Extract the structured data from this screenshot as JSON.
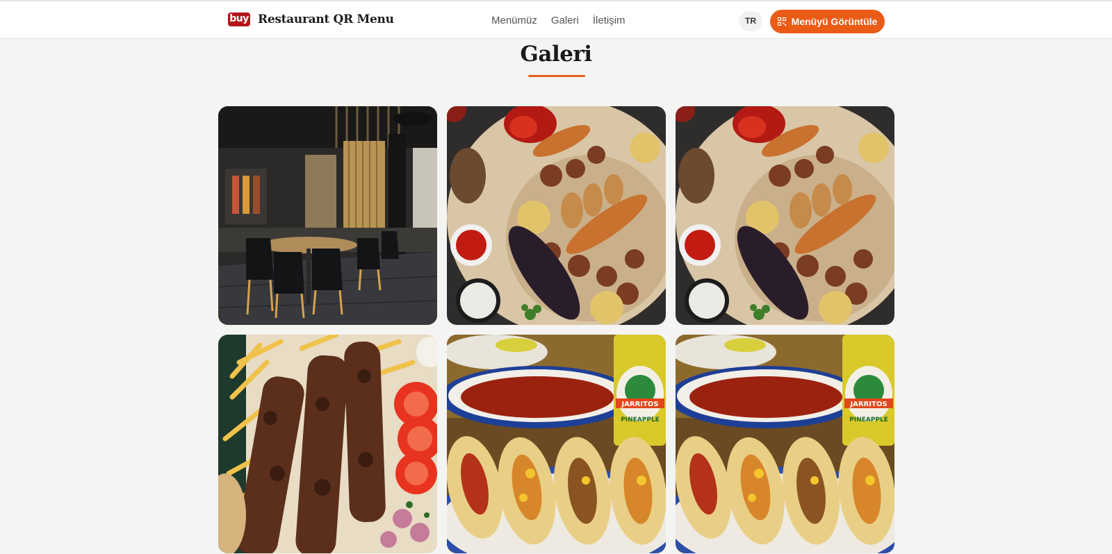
{
  "header": {
    "logo_text": "buy",
    "brand_name": "Restaurant QR Menu",
    "nav": [
      "Menümüz",
      "Galeri",
      "İletişim"
    ],
    "language": "TR",
    "cta_label": "Menüyü Görüntüle",
    "cta_icon": "qr-code-icon"
  },
  "colors": {
    "accent": "#ea5b16",
    "logo": "#b3141b",
    "background": "#f4f4f2"
  },
  "gallery": {
    "title": "Galeri",
    "images": [
      {
        "name": "gallery-image-restaurant-interior",
        "subject": "restaurant interior"
      },
      {
        "name": "gallery-image-mixed-grill",
        "subject": "mixed grill platter"
      },
      {
        "name": "gallery-image-mixed-grill-2",
        "subject": "mixed grill platter"
      },
      {
        "name": "gallery-image-skewers",
        "subject": "meat skewers with fries"
      },
      {
        "name": "gallery-image-tacos",
        "subject": "tacos with salsa and drink"
      },
      {
        "name": "gallery-image-tacos-2",
        "subject": "tacos with salsa and drink"
      }
    ],
    "drink_label_1": "JARRITOS",
    "drink_label_2": "PINEAPPLE"
  }
}
